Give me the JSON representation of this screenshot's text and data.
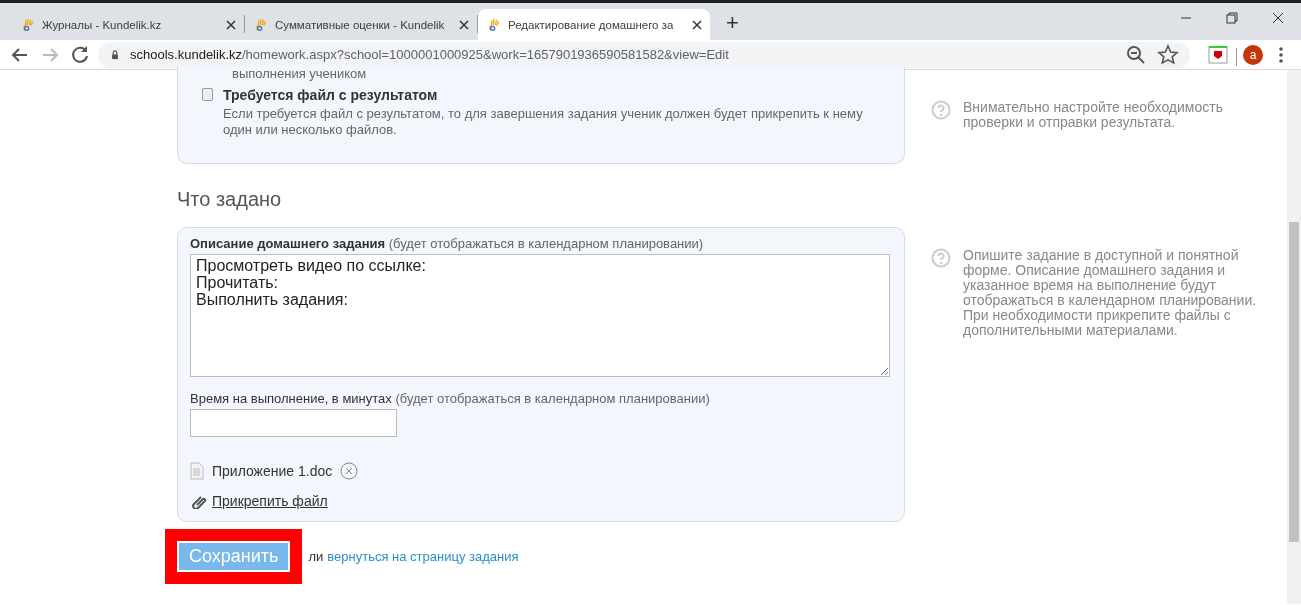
{
  "browser": {
    "tabs": [
      {
        "title": "Журналы - Kundelik.kz",
        "selected": false
      },
      {
        "title": "Суммативные оценки - Kundelik",
        "selected": false
      },
      {
        "title": "Редактирование домашнего за",
        "selected": true
      }
    ],
    "new_tab": "+",
    "url": {
      "host": "schools.kundelik.kz",
      "path": "/homework.aspx?school=1000001000925&work=1657901936590581582&view=Edit"
    },
    "avatar": "a"
  },
  "result_section": {
    "cut_text": "выполнения учеником",
    "checkbox": {
      "label": "Требуется файл с результатом",
      "checked": false,
      "description": "Если требуется файл с результатом, то для завершения задания ученик должен будет прикрепить к нему один или несколько файлов."
    }
  },
  "help": [
    "Внимательно настройте необходимость проверки и отправки результата.",
    "Опишите задание в доступной и понятной форме. Описание домашнего задания и указанное время на выполнение будут отображаться в календарном планировании. При необходимости прикрепите файлы с дополнительными материалами."
  ],
  "section_title": "Что задано",
  "description_field": {
    "label": "Описание домашнего задания",
    "hint": "(будет отображаться в календарном планировании)",
    "value": "Просмотреть видео по ссылке:\nПрочитать:\nВыполнить задания:"
  },
  "time_field": {
    "label": "Время на выполнение, в минутах",
    "hint": "(будет отображаться в календарном планировании)"
  },
  "attachments": [
    {
      "name": "Приложение 1.doc"
    }
  ],
  "attach_link": "Прикрепить файл",
  "save_button": {
    "label": "Сохранить",
    "highlighted": true
  },
  "or_text": "ли",
  "back_link": "вернуться на страницу задания"
}
